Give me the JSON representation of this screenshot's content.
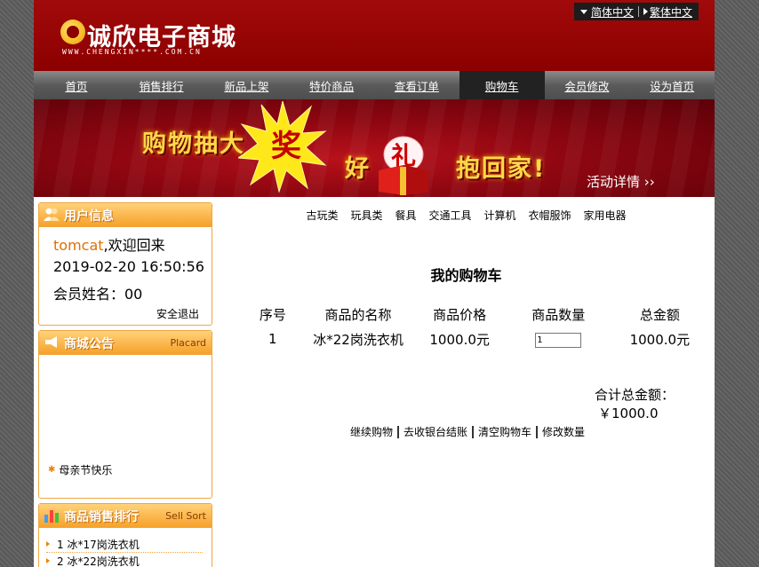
{
  "header": {
    "logo_text": "诚欣电子商城",
    "logo_sub": "WWW.CHENGXIN****.COM.CN",
    "lang": [
      "简体中文",
      "繁体中文"
    ]
  },
  "nav": [
    {
      "label": "首页"
    },
    {
      "label": "销售排行"
    },
    {
      "label": "新品上架"
    },
    {
      "label": "特价商品"
    },
    {
      "label": "查看订单"
    },
    {
      "label": "购物车",
      "active": true
    },
    {
      "label": "会员修改"
    },
    {
      "label": "设为首页"
    }
  ],
  "banner": {
    "text1": "购物抽大",
    "burst_char": "奖",
    "text2": "好",
    "gift_char": "礼",
    "text3": "抱回家!",
    "more": "活动详情 ››"
  },
  "user_box": {
    "title": "用户信息",
    "username": "tomcat",
    "welcome": ",欢迎回来",
    "datetime": "2019-02-20 16:50:56",
    "member_label": "会员姓名：00",
    "logout": "安全退出"
  },
  "notice_box": {
    "title": "商城公告",
    "sub": "Placard",
    "items": [
      "母亲节快乐"
    ]
  },
  "sell_box": {
    "title": "商品销售排行",
    "sub": "Sell Sort",
    "items": [
      "1  冰*17岗洗衣机",
      "2  冰*22岗洗衣机"
    ]
  },
  "categories": [
    "古玩类",
    "玩具类",
    "餐具",
    "交通工具",
    "计算机",
    "衣帽服饰",
    "家用电器"
  ],
  "cart": {
    "title": "我的购物车",
    "headers": [
      "序号",
      "商品的名称",
      "商品价格",
      "商品数量",
      "总金额"
    ],
    "rows": [
      {
        "index": "1",
        "name": "冰*22岗洗衣机",
        "price": "1000.0元",
        "qty": "1",
        "total": "1000.0元"
      }
    ],
    "total_label": "合计总金额：",
    "total_value": "￥1000.0",
    "actions": [
      "继续购物",
      "去收银台结账",
      "清空购物车",
      "修改数量"
    ]
  },
  "colors": {
    "header_red": "#8c0000",
    "nav_gray": "#5a5a5a",
    "box_orange": "#f6a12a",
    "username_orange": "#e07000"
  }
}
